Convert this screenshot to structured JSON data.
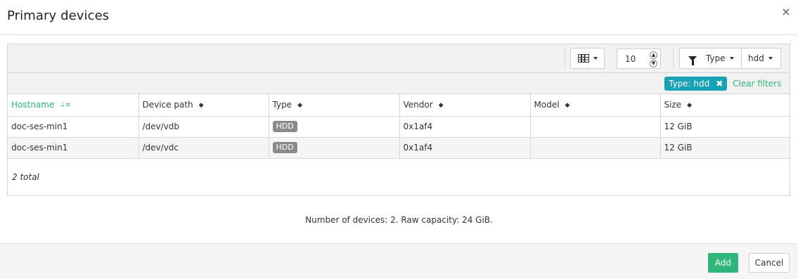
{
  "modal": {
    "title": "Primary devices",
    "close_icon": "×"
  },
  "toolbar": {
    "columns_icon": "table-icon",
    "page_size": "10",
    "spin_up": "▲",
    "spin_down": "▼",
    "filter_icon": "funnel-icon",
    "filter_field": "Type",
    "filter_value": "hdd"
  },
  "active_filter": {
    "chip_label": "Type: hdd",
    "chip_remove": "✖",
    "clear_label": "Clear filters"
  },
  "table": {
    "columns": [
      {
        "label": "Hostname",
        "sort_icon": "⇣≡",
        "sorted": true
      },
      {
        "label": "Device path",
        "sort_icon": "◆"
      },
      {
        "label": "Type",
        "sort_icon": "◆"
      },
      {
        "label": "Vendor",
        "sort_icon": "◆"
      },
      {
        "label": "Model",
        "sort_icon": "◆"
      },
      {
        "label": "Size",
        "sort_icon": "◆"
      }
    ],
    "rows": [
      {
        "hostname": "doc-ses-min1",
        "path": "/dev/vdb",
        "type": "HDD",
        "vendor": "0x1af4",
        "model": "",
        "size": "12 GiB"
      },
      {
        "hostname": "doc-ses-min1",
        "path": "/dev/vdc",
        "type": "HDD",
        "vendor": "0x1af4",
        "model": "",
        "size": "12 GiB"
      }
    ],
    "total": "2 total"
  },
  "summary": "Number of devices: 2. Raw capacity: 24 GiB.",
  "footer": {
    "add_label": "Add",
    "cancel_label": "Cancel"
  },
  "colors": {
    "accent": "#2fb67b",
    "chip": "#17a2b8",
    "badge": "#8a8a8a"
  }
}
